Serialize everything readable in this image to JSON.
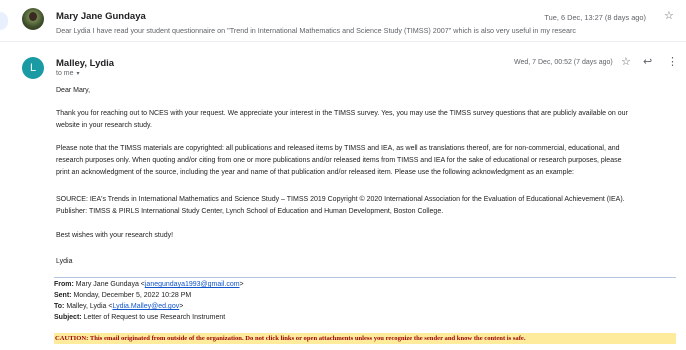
{
  "collapsed_message": {
    "sender": "Mary Jane Gundaya",
    "snippet": "Dear Lydia I have read your student questionnaire on \"Trend in International Mathematics and Science Study (TIMSS) 2007\" which is also very useful in my researc",
    "date": "Tue, 6 Dec, 13:27 (8 days ago)",
    "star_icon": "☆"
  },
  "expanded_message": {
    "avatar_letter": "L",
    "sender": "Malley, Lydia",
    "to_label": "to me",
    "caret": "▾",
    "date": "Wed, 7 Dec, 00:52 (7 days ago)",
    "star_icon": "☆",
    "reply_icon": "↩",
    "more_icon": "⋮",
    "greeting": "Dear Mary,",
    "p1_line1": "Thank you for reaching out to NCES with your request. We appreciate your interest in the TIMSS survey. Yes, you may use the TIMSS survey questions that are publicly available on our",
    "p1_line2": "website in your research study.",
    "p2_line1": "Please note that the TIMSS materials are copyrighted: all publications and released items by TIMSS and IEA, as well as translations thereof, are for non-commercial, educational, and",
    "p2_line2": "research purposes only. When quoting and/or citing from one or more publications and/or released items from TIMSS and IEA for the sake of educational or research purposes, please",
    "p2_line3": "print an acknowledgment of the source, including the year and name of that publication and/or released item. Please use the following acknowledgment as an example:",
    "p3_line1": "SOURCE: IEA's Trends in International Mathematics and Science Study – TIMSS 2019 Copyright © 2020 International Association for the Evaluation of Educational Achievement (IEA).",
    "p3_line2": "Publisher: TIMSS & PIRLS International Study Center, Lynch School of Education and Human Development, Boston College.",
    "closing": "Best wishes with your research study!",
    "signature": "Lydia",
    "quoted_header": {
      "from_label": "From:",
      "from_name": "Mary Jane Gundaya <",
      "from_email": "janegundaya1993@gmail.com",
      "from_end": ">",
      "sent_label": "Sent:",
      "sent_value": "Monday, December 5, 2022 10:28 PM",
      "to_label": "To:",
      "to_name": "Malley, Lydia <",
      "to_email": "Lydia.Malley@ed.gov",
      "to_end": ">",
      "subject_label": "Subject:",
      "subject_value": "Letter of Request to use Research Instrument"
    },
    "caution": "CAUTION: This email originated from outside of the organization. Do not click links or open attachments unless you recognize the sender and know the content is safe."
  },
  "colors": {
    "avatar": "#1a9ba3",
    "link": "#1155cc",
    "caution_bg": "#ffeb9c",
    "caution_text": "#9c0006"
  }
}
